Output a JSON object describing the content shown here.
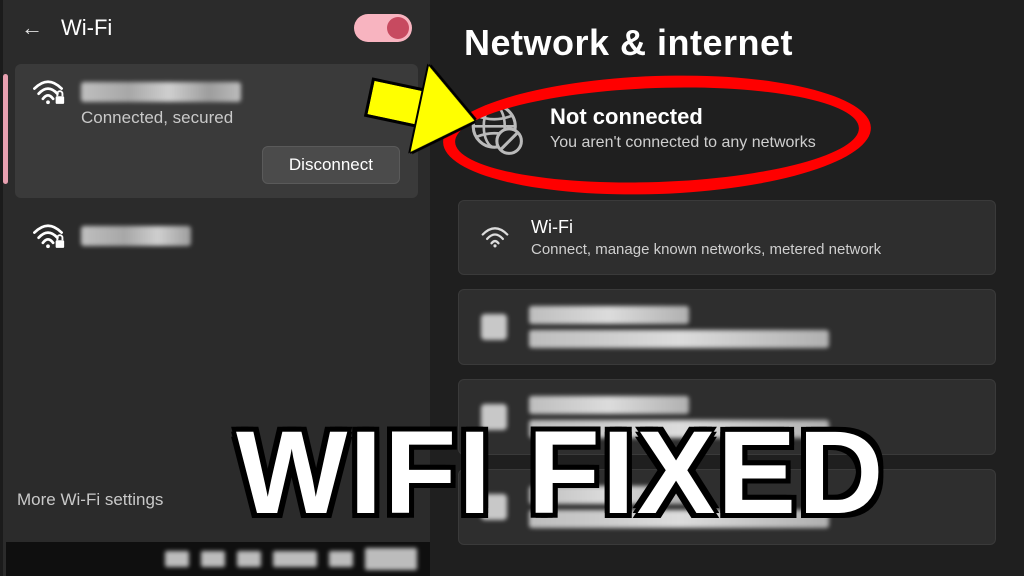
{
  "wifi_panel": {
    "title": "Wi-Fi",
    "toggle_on": true,
    "connected_network": {
      "name_redacted": true,
      "status": "Connected, secured",
      "disconnect_label": "Disconnect"
    },
    "other_network": {
      "name_redacted": true
    },
    "more_settings_label": "More Wi-Fi settings"
  },
  "settings_panel": {
    "title": "Network & internet",
    "status": {
      "line1": "Not connected",
      "line2": "You aren't connected to any networks"
    },
    "wifi_row": {
      "title": "Wi-Fi",
      "subtitle": "Connect, manage known networks, metered network"
    }
  },
  "caption": "WIFI FIXED"
}
